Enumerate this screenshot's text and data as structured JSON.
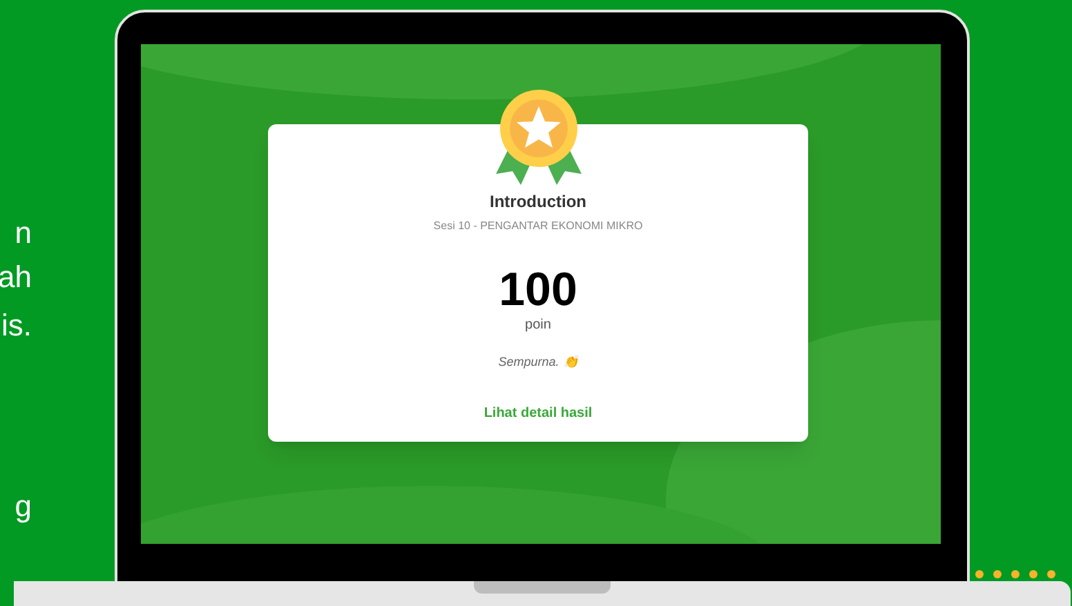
{
  "side_text_lines": [
    "n",
    "ah",
    "is.",
    "g"
  ],
  "result_card": {
    "title": "Introduction",
    "subtitle": "Sesi 10 - PENGANTAR EKONOMI MIKRO",
    "score": "100",
    "score_unit": "poin",
    "remark": "Sempurna. 👏",
    "link": "Lihat detail hasil"
  }
}
